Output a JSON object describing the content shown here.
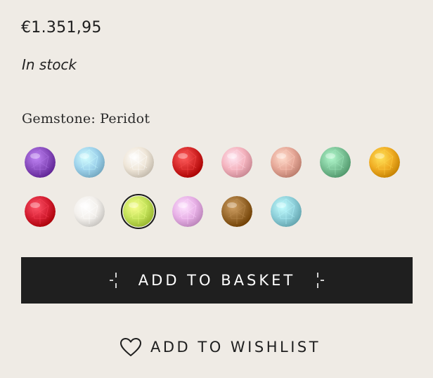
{
  "product": {
    "price": "€1.351,95",
    "stock_status": "In stock"
  },
  "gemstone": {
    "label": "Gemstone: Peridot",
    "selected": "peridot",
    "options": [
      {
        "id": "amethyst",
        "color": "#8b4fc0"
      },
      {
        "id": "blue-topaz",
        "color": "#9fd3ec"
      },
      {
        "id": "moonstone",
        "color": "#efe6d8"
      },
      {
        "id": "coral",
        "color": "#d42828"
      },
      {
        "id": "rose-quartz",
        "color": "#f4b3be"
      },
      {
        "id": "rhodochrosite",
        "color": "#e6a898"
      },
      {
        "id": "aventurine",
        "color": "#7cc397"
      },
      {
        "id": "citrine",
        "color": "#f0ad24"
      },
      {
        "id": "ruby",
        "color": "#d62034"
      },
      {
        "id": "pearl",
        "color": "#f3f0ec"
      },
      {
        "id": "peridot",
        "color": "#c4e25a"
      },
      {
        "id": "pink-sapphire",
        "color": "#e7b0e6"
      },
      {
        "id": "smoky-quartz",
        "color": "#9a6a2e"
      },
      {
        "id": "amazonite",
        "color": "#8fd0da"
      }
    ]
  },
  "actions": {
    "basket_label": "ADD TO BASKET",
    "wishlist_label": "ADD TO WISHLIST"
  },
  "colors": {
    "background": "#efebe5",
    "button": "#1f1f1f",
    "button_text": "#ffffff"
  },
  "icons": {
    "sparkle": "sparkle-icon",
    "wishlist": "heart-icon"
  }
}
